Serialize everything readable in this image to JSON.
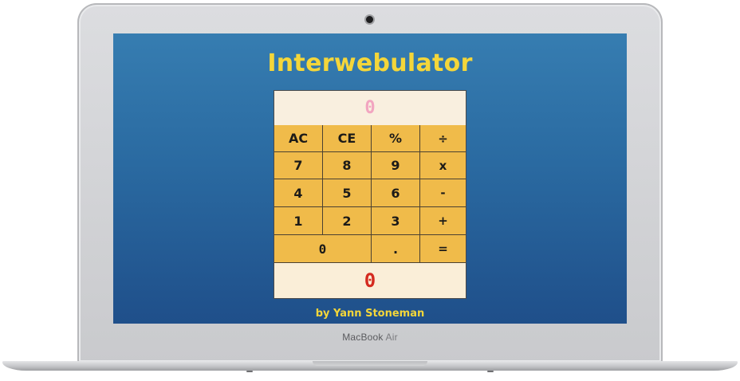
{
  "app": {
    "title": "Interwebulator",
    "credit": "by Yann Stoneman"
  },
  "display": {
    "input": "0",
    "result": "0"
  },
  "keys": {
    "ac": "AC",
    "ce": "CE",
    "percent": "%",
    "divide": "÷",
    "seven": "7",
    "eight": "8",
    "nine": "9",
    "multiply": "x",
    "four": "4",
    "five": "5",
    "six": "6",
    "subtract": "-",
    "one": "1",
    "two": "2",
    "three": "3",
    "add": "+",
    "zero": "0",
    "decimal": ".",
    "equals": "="
  },
  "device": {
    "brand": "MacBook",
    "model": "Air"
  },
  "colors": {
    "background_top": "#367db1",
    "background_bottom": "#1f4f8a",
    "title": "#f4d63a",
    "key_fill": "#f0bb4a",
    "display_fill": "#faefdf",
    "input_text": "#f2a5c0",
    "result_text": "#d42a1f"
  }
}
